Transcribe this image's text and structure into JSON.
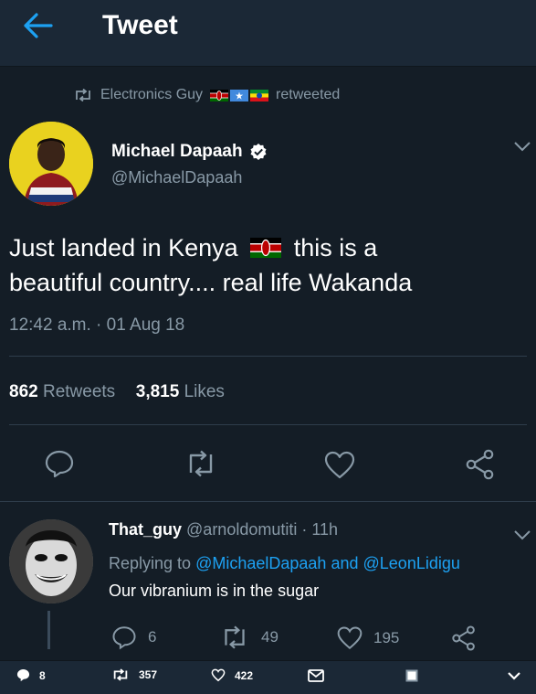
{
  "header": {
    "title": "Tweet"
  },
  "retweet_notice": {
    "user": "Electronics Guy",
    "suffix": "retweeted"
  },
  "tweet": {
    "author_name": "Michael Dapaah",
    "author_handle": "@MichaelDapaah",
    "text_part1": "Just landed in Kenya",
    "text_part2": "this is a",
    "text_line2": "beautiful country.... real life Wakanda",
    "time": "12:42 a.m. · 01 Aug 18",
    "retweets_count": "862",
    "retweets_label": "Retweets",
    "likes_count": "3,815",
    "likes_label": "Likes"
  },
  "reply": {
    "name": "That_guy",
    "handle": "@arnoldomutiti",
    "time": "· 11h",
    "replying_prefix": "Replying to",
    "mention1": "@MichaelDapaah",
    "and_word": "and",
    "mention2": "@LeonLidigu",
    "text": "Our vibranium is in the sugar",
    "replies": "6",
    "retweets": "49",
    "likes": "195"
  },
  "bottom_bar": {
    "replies": "8",
    "retweets": "357",
    "likes": "422"
  },
  "colors": {
    "background": "#141d26",
    "header": "#1b2836",
    "accent": "#1da1f2",
    "muted": "#8899a6"
  }
}
